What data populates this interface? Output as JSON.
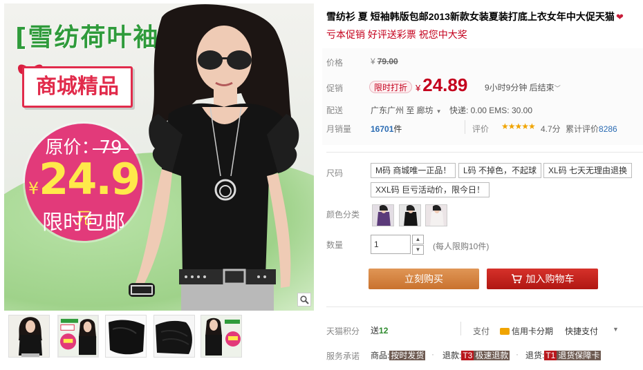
{
  "image": {
    "banner_title": "[雪纺荷叶袖]",
    "badge": "商城精品",
    "orig_price_text": "原价：79",
    "big_price_yen": "¥",
    "big_price": "24.9",
    "big_price_unit": "元",
    "promo_text": "限时包邮"
  },
  "product": {
    "title": "雪纺衫 夏 短袖韩版包邮2013新款女装夏装打底上衣女年中大促天猫",
    "subtitle": "亏本促销 好评送彩票 祝您中大奖"
  },
  "price": {
    "label": "价格",
    "original_currency": "¥",
    "original": "79.00",
    "promo_label": "促销",
    "promo_tag": "限时打折",
    "promo_currency": "¥",
    "promo_price": "24.89",
    "countdown": "9小时9分钟 后结束"
  },
  "shipping": {
    "label": "配送",
    "text": "广东广州 至 廊坊",
    "rates": "快递: 0.00 EMS: 30.00"
  },
  "sales": {
    "label": "月销量",
    "count": "16701",
    "unit": "件",
    "rating_label": "评价",
    "stars": "★★★★★",
    "rating": 4.7,
    "score": "4.7分",
    "reviews_prefix": "累计评价",
    "reviews": "8286"
  },
  "size": {
    "label": "尺码",
    "options": [
      "M码 商城唯一正品！",
      "L码 不掉色，不起球",
      "XL码 七天无理由退换",
      "XXL码 巨亏活动价，限今日！"
    ]
  },
  "color": {
    "label": "颜色分类"
  },
  "quantity": {
    "label": "数量",
    "value": "1",
    "limit": "(每人限购10件)"
  },
  "actions": {
    "buy_now": "立刻购买",
    "add_to_cart": "加入购物车"
  },
  "points": {
    "label": "天猫积分",
    "prefix": "送",
    "value": "12",
    "pay_label": "支付",
    "credit": "信用卡分期",
    "quickpay": "快捷支付"
  },
  "service": {
    "label": "服务承诺",
    "goods_prefix": "商品:",
    "goods_tag": "按时发货",
    "refund_prefix": "退款:",
    "refund_code": "T3",
    "refund_tag": "极速退款",
    "return_prefix": "退货:",
    "return_code": "T1",
    "return_tag": "退货保障卡"
  },
  "colors": {
    "price_red": "#c4001d",
    "buy_orange": "#c9722e",
    "cart_red": "#b01712",
    "link_blue": "#2a6bb3",
    "banner_green": "#2f9b3b",
    "circle_pink": "#e23a7a"
  }
}
